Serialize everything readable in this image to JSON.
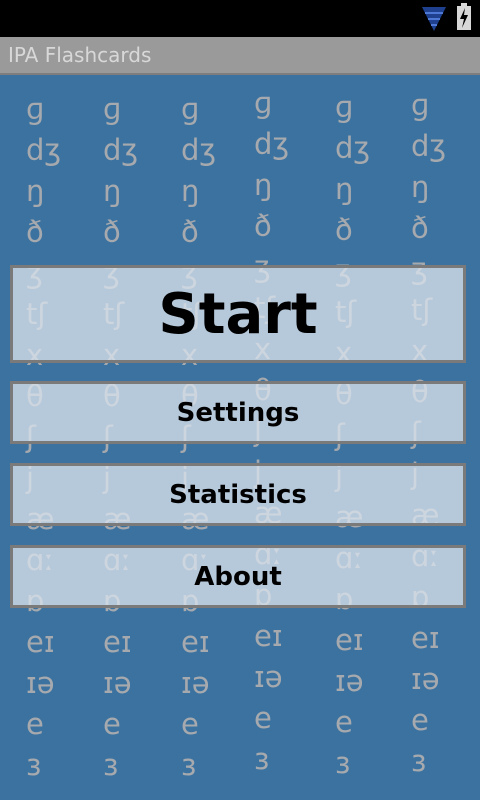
{
  "app": {
    "title": "IPA Flashcards"
  },
  "status_bar": {
    "icons": [
      "signal-icon",
      "battery-charging-icon"
    ]
  },
  "background_symbols": [
    [
      "ɡ",
      "dʒ",
      "ŋ",
      "ð",
      "ʒ",
      "tʃ",
      "x",
      "θ",
      "ʃ",
      "j",
      "æ",
      "ɑː",
      "ɒ",
      "eɪ",
      "ɪə",
      "e",
      "ɜ"
    ],
    [
      "ɡ",
      "dʒ",
      "ŋ",
      "ð",
      "ʒ",
      "tʃ",
      "x",
      "θ",
      "ʃ",
      "j",
      "æ",
      "ɑː",
      "ɒ",
      "eɪ",
      "ɪə",
      "e",
      "ɜ"
    ],
    [
      "ɡ",
      "dʒ",
      "ŋ",
      "ð",
      "ʒ",
      "tʃ",
      "x",
      "θ",
      "ʃ",
      "j",
      "æ",
      "ɑː",
      "ɒ",
      "eɪ",
      "ɪə",
      "e",
      "ɜ"
    ],
    [
      "ɡ",
      "dʒ",
      "ŋ",
      "ð",
      "ʒ",
      "tʃ",
      "x",
      "θ",
      "ʃ",
      "j",
      "æ",
      "ɑː",
      "ɒ",
      "eɪ",
      "ɪə",
      "e",
      "ɜ"
    ],
    [
      "ɡ",
      "dʒ",
      "ŋ",
      "ð",
      "ʒ",
      "tʃ",
      "x",
      "θ",
      "ʃ",
      "j",
      "æ",
      "ɑː",
      "ɒ",
      "eɪ",
      "ɪə",
      "e",
      "ɜ"
    ],
    [
      "ɡ",
      "dʒ",
      "ŋ",
      "ð",
      "ʒ",
      "tʃ",
      "x",
      "θ",
      "ʃ",
      "j",
      "æ",
      "ɑː",
      "ɒ",
      "eɪ",
      "ɪə",
      "e",
      "ɜ"
    ]
  ],
  "menu": {
    "start_label": "Start",
    "settings_label": "Settings",
    "statistics_label": "Statistics",
    "about_label": "About"
  },
  "colors": {
    "background": "#3b72a0",
    "title_bar": "#9a9a9a",
    "button_fill": "#d8e2ec",
    "button_border": "#7a7a7a",
    "symbol_color": "#a6a9ad"
  }
}
